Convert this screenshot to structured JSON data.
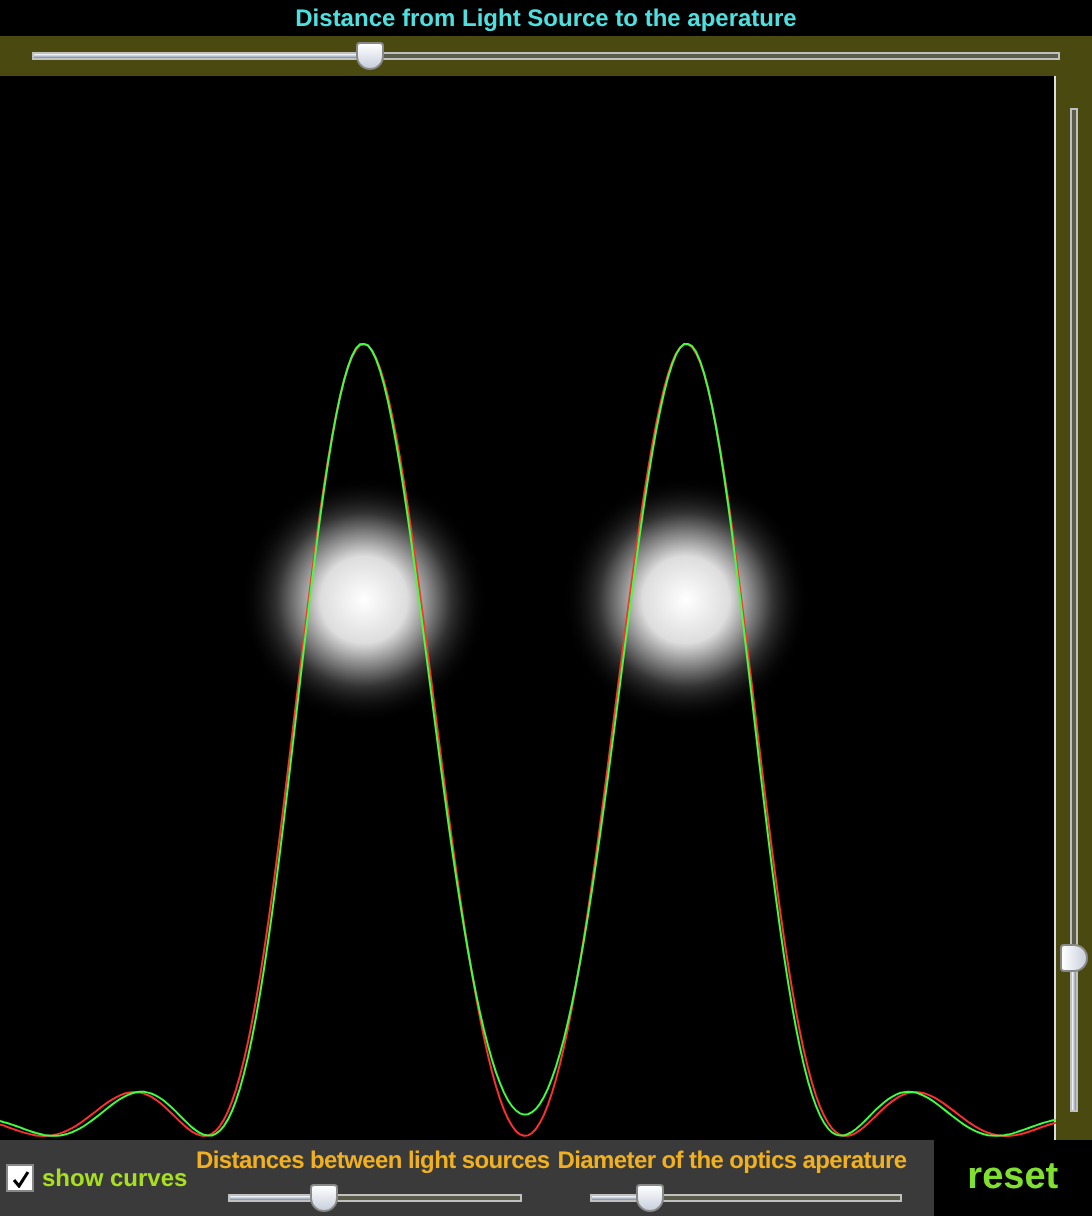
{
  "top_slider": {
    "label": "Distance from Light Source to the aperature",
    "level": 0.32
  },
  "side_slider": {
    "level": 0.15
  },
  "show_curves": {
    "label": "show curves",
    "checked": true
  },
  "bottom_sliders": [
    {
      "label": "Distances between light sources",
      "level": 0.3
    },
    {
      "label": "Diameter of the optics aperature",
      "level": 0.18
    }
  ],
  "reset_button": {
    "label": "reset"
  }
}
